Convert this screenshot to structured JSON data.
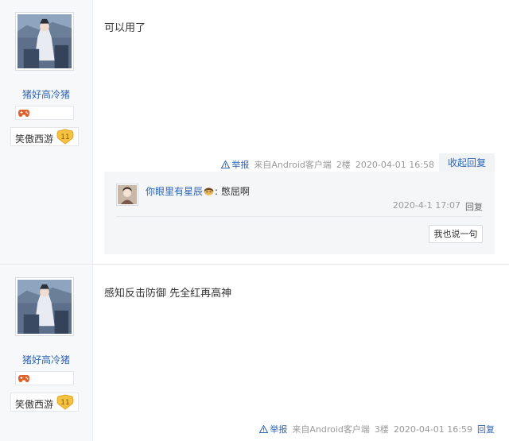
{
  "posts": [
    {
      "username": "猪好高冷猪",
      "level_name": "笑傲西游",
      "level": "11",
      "content": "可以用了",
      "report_label": "举报",
      "source": "来自Android客户端",
      "floor": "2楼",
      "time": "2020-04-01 16:58",
      "reply_toggle": "收起回复",
      "sub_reply": {
        "username": "你眼里有星辰",
        "text": ": 憋屈啊",
        "time": "2020-4-1 17:07",
        "reply_label": "回复",
        "say_button": "我也说一句"
      }
    },
    {
      "username": "猪好高冷猪",
      "level_name": "笑傲西游",
      "level": "11",
      "content": "感知反击防御 先全红再高神",
      "report_label": "举报",
      "source": "来自Android客户端",
      "floor": "3楼",
      "time": "2020-04-01 16:59",
      "reply_label": "回复"
    }
  ],
  "colors": {
    "link": "#2d64b3",
    "meta": "#999999",
    "side_bg": "#f7f8fa",
    "level_badge": "#f5c242"
  },
  "icons": [
    "gamepad-icon",
    "level-shield-icon",
    "warning-icon",
    "face-icon"
  ]
}
